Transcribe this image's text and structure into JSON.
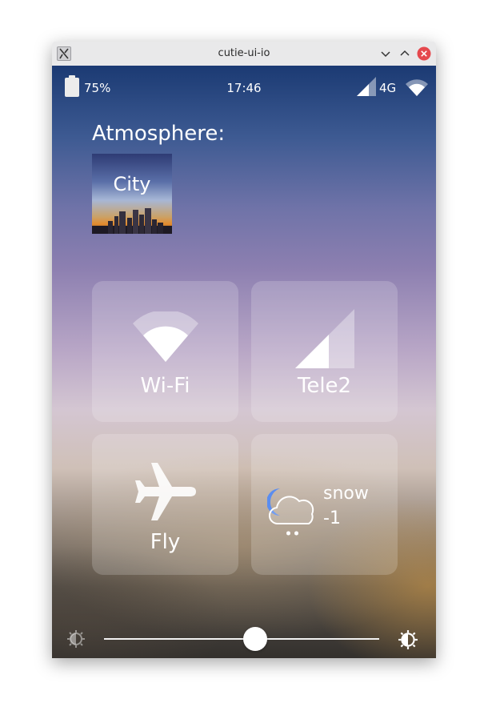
{
  "window": {
    "title": "cutie-ui-io"
  },
  "status_bar": {
    "battery_percent": "75%",
    "time": "17:46",
    "network": "4G"
  },
  "atmosphere": {
    "title": "Atmosphere:",
    "selected": "City"
  },
  "tiles": {
    "wifi": {
      "label": "Wi-Fi",
      "icon": "wifi-icon"
    },
    "cellular": {
      "label": "Tele2",
      "icon": "signal-icon"
    },
    "airplane": {
      "label": "Fly",
      "icon": "airplane-icon"
    },
    "weather": {
      "condition": "snow",
      "temperature": "-1",
      "icon": "snow-cloud-icon"
    }
  },
  "brightness": {
    "level": 0.55
  },
  "colors": {
    "titlebar": "#e9e9ea",
    "close_button": "#e5484d",
    "tile_background": "rgba(255,255,255,0.18)",
    "weather_moon": "#5b8def"
  }
}
